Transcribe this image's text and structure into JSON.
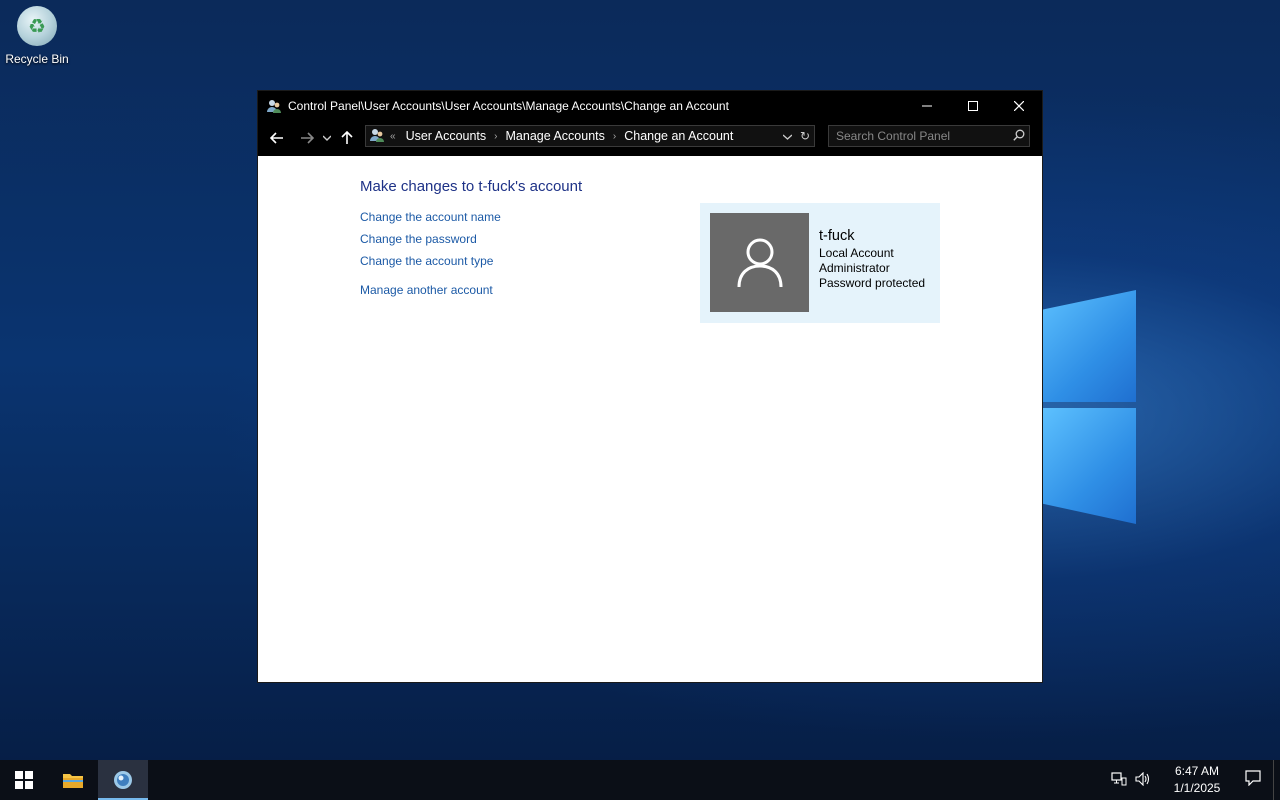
{
  "desktop": {
    "icons": [
      {
        "label": "Recycle Bin",
        "icon": "recycle-bin-icon"
      }
    ]
  },
  "window": {
    "title": "Control Panel\\User Accounts\\User Accounts\\Manage Accounts\\Change an Account",
    "controls": {
      "minimize": "—",
      "maximize": "☐",
      "close": "✕"
    }
  },
  "navigation": {
    "breadcrumb_prefix": "«",
    "breadcrumbs": [
      "User Accounts",
      "Manage Accounts",
      "Change an Account"
    ],
    "search_placeholder": "Search Control Panel"
  },
  "content": {
    "heading": "Make changes to t-fuck's account",
    "links": [
      "Change the account name",
      "Change the password",
      "Change the account type",
      "Manage another account"
    ],
    "account": {
      "name": "t-fuck",
      "type": "Local Account",
      "role": "Administrator",
      "status": "Password protected"
    }
  },
  "taskbar": {
    "time": "6:47 AM",
    "date": "1/1/2025"
  },
  "colors": {
    "link": "#1c5aa6",
    "heading": "#1e3287",
    "card_bg": "#e5f3fb",
    "avatar_bg": "#696969",
    "taskbar_accent": "#76b9ed"
  }
}
